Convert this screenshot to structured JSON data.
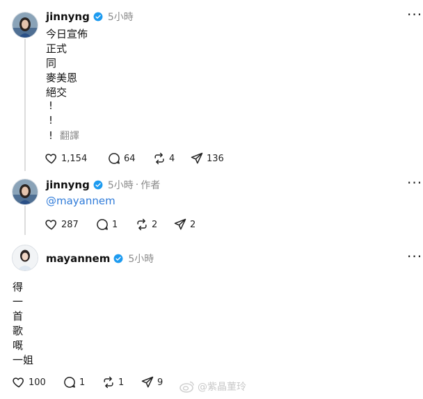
{
  "posts": [
    {
      "username": "jinnyng",
      "time": "5小時",
      "lines": [
        "今日宣佈",
        "正式",
        "同",
        "麥美恩",
        "絕交",
        "!",
        "!",
        "!"
      ],
      "translate": "翻譯",
      "actions": {
        "likes": "1,154",
        "comments": "64",
        "reposts": "4",
        "shares": "136"
      }
    },
    {
      "username": "jinnyng",
      "time": "5小時",
      "author_tag": "作者",
      "mention": "@mayannem",
      "actions": {
        "likes": "287",
        "comments": "1",
        "reposts": "2",
        "shares": "2"
      }
    },
    {
      "username": "mayannem",
      "time": "5小時",
      "lines": [
        "得",
        "一",
        "首",
        "歌",
        "嘅",
        "一姐"
      ],
      "actions": {
        "likes": "100",
        "comments": "1",
        "reposts": "1",
        "shares": "9"
      }
    }
  ],
  "watermark": "@紫晶菫玲",
  "icons": [
    "avatar",
    "verified-badge-icon",
    "more-icon",
    "heart-icon",
    "comment-icon",
    "repost-icon",
    "share-icon",
    "weibo-icon"
  ],
  "colors": {
    "verified": "#1d9bf0",
    "mention": "#2f7bd9",
    "meta": "#8a8a8a",
    "thread_line": "#dcdcdc"
  }
}
